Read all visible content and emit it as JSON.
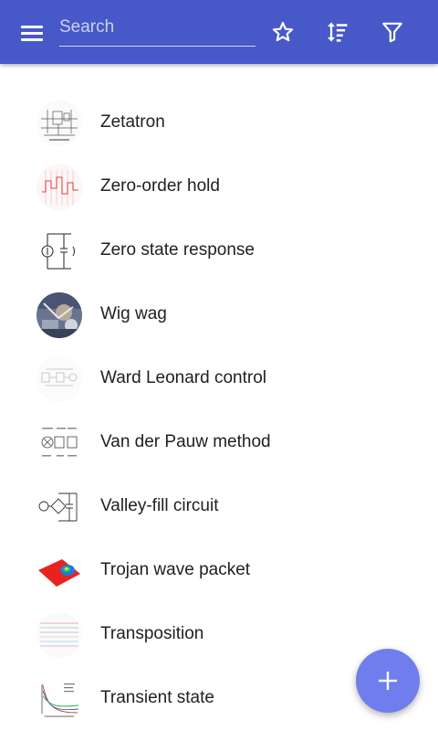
{
  "appbar": {
    "background": "#4758c9",
    "menu_icon": "menu-icon",
    "search": {
      "placeholder": "Search",
      "value": ""
    },
    "actions": [
      "star-icon",
      "sort-icon",
      "filter-icon"
    ]
  },
  "list": {
    "items": [
      {
        "label": "Zetatron",
        "thumb": "circuit-schematic"
      },
      {
        "label": "Zero-order hold",
        "thumb": "step-signal-plot"
      },
      {
        "label": "Zero state response",
        "thumb": "circuit-diagram"
      },
      {
        "label": "Wig wag",
        "thumb": "photo"
      },
      {
        "label": "Ward Leonard control",
        "thumb": "block-diagram"
      },
      {
        "label": "Van der Pauw method",
        "thumb": "sample-diagrams"
      },
      {
        "label": "Valley-fill circuit",
        "thumb": "rectifier-circuit"
      },
      {
        "label": "Trojan wave packet",
        "thumb": "3d-surface"
      },
      {
        "label": "Transposition",
        "thumb": "line-pattern"
      },
      {
        "label": "Transient state",
        "thumb": "decay-plot"
      }
    ]
  },
  "fab": {
    "icon": "plus-icon",
    "color": "#6f7eec"
  }
}
